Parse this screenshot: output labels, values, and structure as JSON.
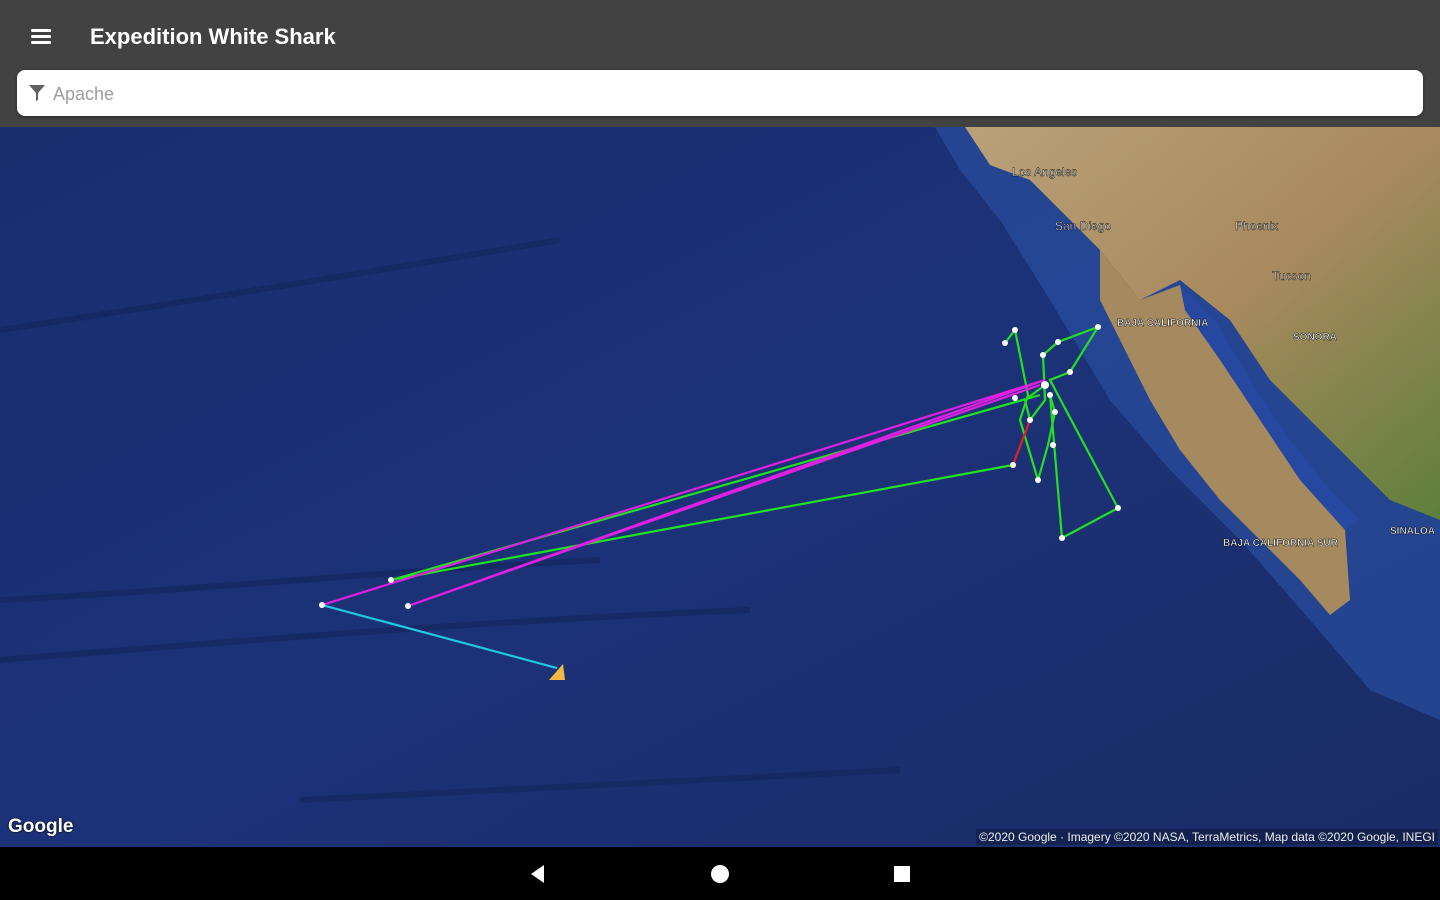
{
  "app": {
    "title": "Expedition White Shark"
  },
  "search": {
    "placeholder": "Apache",
    "value": ""
  },
  "map": {
    "labels": [
      "Los Angeles",
      "San Diego",
      "Phoenix",
      "Tucson",
      "BAJA CALIFORNIA",
      "SONORA",
      "BAJA CALIFORNIA SUR",
      "SINALOA"
    ],
    "track_colors": {
      "green": "#22e022",
      "magenta": "#e020e0",
      "cyan": "#22c8e0",
      "red": "#e02020",
      "marker": "#f5b942"
    },
    "google_logo": "Google",
    "attribution": "©2020 Google · Imagery ©2020 NASA, TerraMetrics, Map data ©2020 Google, INEGI"
  },
  "icons": {
    "menu": "hamburger-icon",
    "filter": "filter-icon",
    "back": "back-triangle-icon",
    "home": "home-circle-icon",
    "recents": "recents-square-icon"
  }
}
